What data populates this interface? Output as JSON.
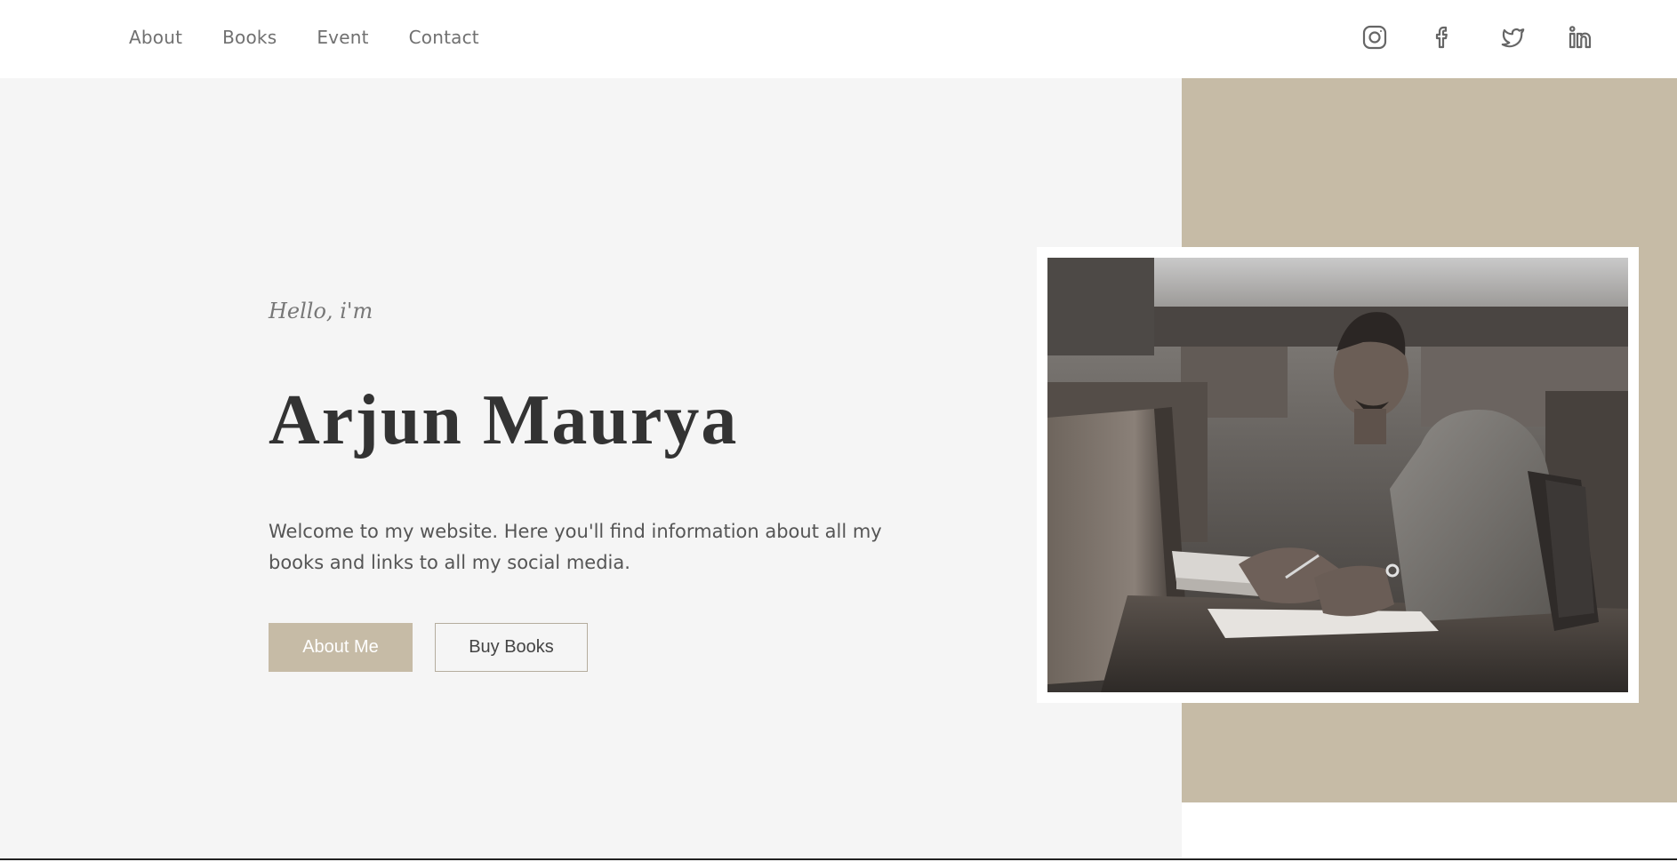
{
  "nav": {
    "links": [
      "About",
      "Books",
      "Event",
      "Contact"
    ]
  },
  "social": [
    {
      "name": "instagram-icon"
    },
    {
      "name": "facebook-icon"
    },
    {
      "name": "twitter-icon"
    },
    {
      "name": "linkedin-icon"
    }
  ],
  "hero": {
    "greeting": "Hello, i'm",
    "name": "Arjun Maurya",
    "intro": "Welcome to my website. Here you'll find information about all my books and links to all my social media.",
    "primary_button": "About Me",
    "secondary_button": "Buy Books"
  },
  "colors": {
    "accent": "#c6bba6",
    "background": "#f5f5f5",
    "text_dark": "#333333",
    "text_muted": "#707070"
  }
}
